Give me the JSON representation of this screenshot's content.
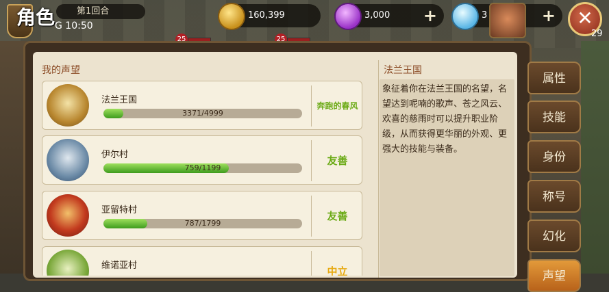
{
  "header": {
    "title": "角色",
    "round": "第1回合",
    "time": "G 10:50"
  },
  "resources": [
    {
      "name": "coin-icon",
      "value": "160,399"
    },
    {
      "name": "gem-icon",
      "value": "3,000",
      "plus": "+"
    },
    {
      "name": "diamond-icon",
      "value": "3",
      "plus": "+"
    }
  ],
  "close_symbol": "✕",
  "level_badges": [
    "25",
    "25"
  ],
  "corner_number": "29",
  "reputation": {
    "title": "我的声望",
    "items": [
      {
        "name": "法兰王国",
        "progress": "3371/4999",
        "ratio": 0.1,
        "status": "奔跑的春风"
      },
      {
        "name": "伊尔村",
        "progress": "759/1199",
        "ratio": 0.63,
        "status": "友善"
      },
      {
        "name": "亚留特村",
        "progress": "787/1799",
        "ratio": 0.22,
        "status": "友善"
      },
      {
        "name": "维诺亚村",
        "progress": "",
        "ratio": 0,
        "status": "中立"
      }
    ]
  },
  "detail": {
    "title": "法兰王国",
    "description": "象征着你在法兰王国的名望，名望达到呢喃的歌声、苍之风云、欢喜的慈雨时可以提升职业阶级，从而获得更华丽的外观、更强大的技能与装备。"
  },
  "tabs": [
    "属性",
    "技能",
    "身份",
    "称号",
    "幻化",
    "声望"
  ],
  "colors": {
    "accent": "#e39a3a",
    "progress": "#4caf20",
    "friendly": "#6aaa14",
    "neutral": "#e7a90f"
  }
}
